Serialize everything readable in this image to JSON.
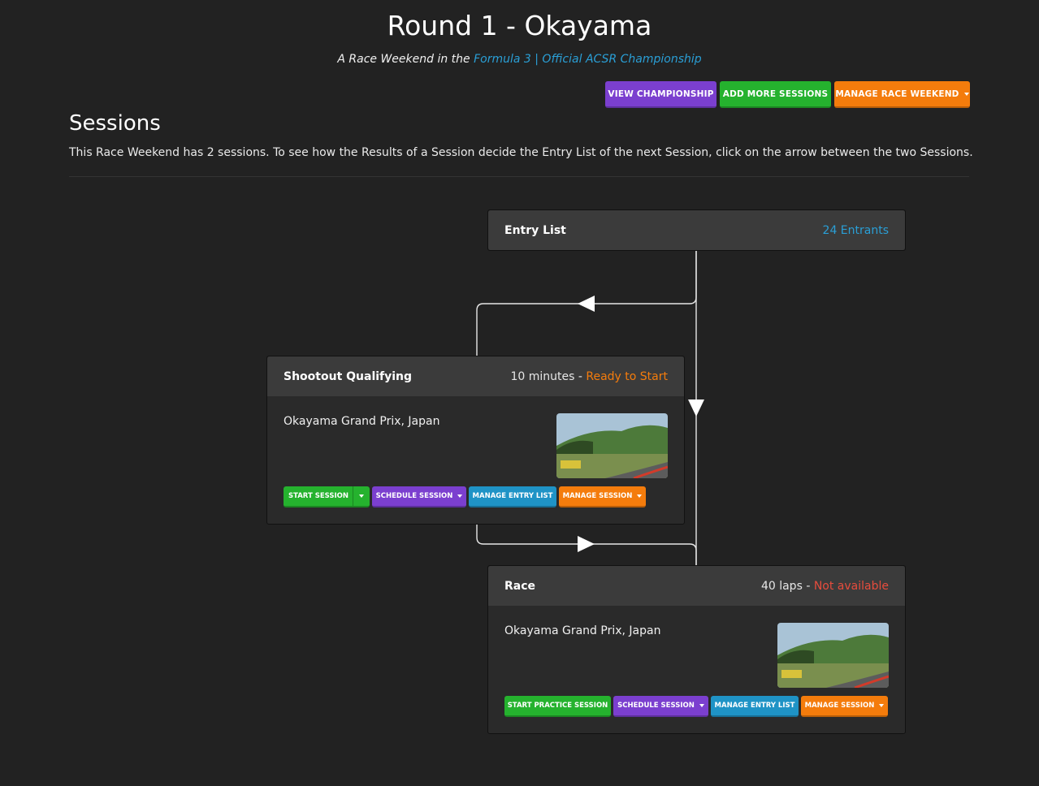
{
  "page": {
    "title": "Round 1 - Okayama",
    "subtitle_prefix": "A Race Weekend in the ",
    "championship_link": "Formula 3 | Official ACSR Championship"
  },
  "toolbar": {
    "view_championship": "VIEW CHAMPIONSHIP",
    "add_more_sessions": "ADD MORE SESSIONS",
    "manage_race_weekend": "MANAGE RACE WEEKEND"
  },
  "sessions": {
    "heading": "Sessions",
    "description": "This Race Weekend has 2 sessions. To see how the Results of a Session decide the Entry List of the next Session, click on the arrow between the two Sessions."
  },
  "entry_list": {
    "title": "Entry List",
    "entrants": "24 Entrants"
  },
  "qualifying": {
    "title": "Shootout Qualifying",
    "duration": "10 minutes - ",
    "status": "Ready to Start",
    "track": "Okayama Grand Prix, Japan",
    "buttons": {
      "start": "START SESSION",
      "schedule": "SCHEDULE SESSION",
      "entry_list": "MANAGE ENTRY LIST",
      "manage": "MANAGE SESSION"
    }
  },
  "race": {
    "title": "Race",
    "duration": "40 laps - ",
    "status": "Not available",
    "track": "Okayama Grand Prix, Japan",
    "buttons": {
      "start": "START PRACTICE SESSION",
      "schedule": "SCHEDULE SESSION",
      "entry_list": "MANAGE ENTRY LIST",
      "manage": "MANAGE SESSION"
    }
  },
  "colors": {
    "background": "#222222",
    "purple": "#7b3fcf",
    "green": "#25b22e",
    "orange": "#f47c0c",
    "blue": "#1f93c6",
    "link": "#2a9fd6",
    "error": "#e74c3c"
  }
}
